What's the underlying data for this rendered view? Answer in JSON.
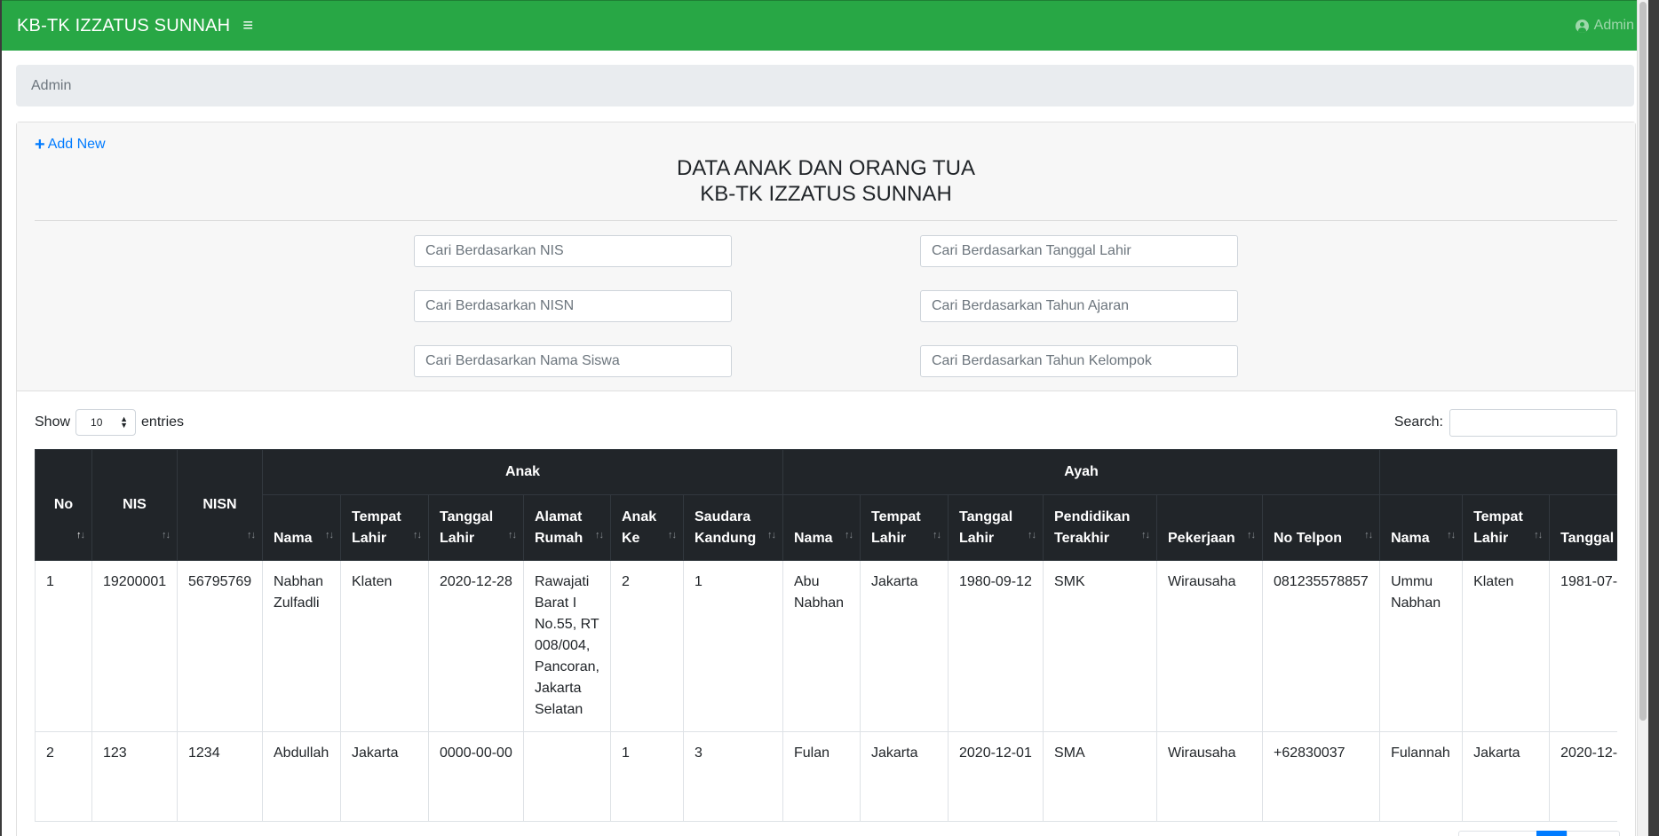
{
  "navbar": {
    "brand": "KB-TK IZZATUS SUNNAH",
    "menu_icon": "hamburger-icon",
    "user_label": "Admin",
    "user_icon": "user-circle-icon",
    "color": "#28a745"
  },
  "breadcrumb": {
    "label": "Admin"
  },
  "header": {
    "add_new_label": "Add New",
    "add_new_icon": "plus-icon",
    "title_line1": "DATA ANAK DAN ORANG TUA",
    "title_line2": "KB-TK IZZATUS SUNNAH"
  },
  "filters": {
    "nis": "Cari Berdasarkan NIS",
    "nisn": "Cari Berdasarkan NISN",
    "nama_siswa": "Cari Berdasarkan Nama Siswa",
    "tanggal_lahir": "Cari Berdasarkan Tanggal Lahir",
    "tahun_ajaran": "Cari Berdasarkan Tahun Ajaran",
    "tahun_kelompok": "Cari Berdasarkan Tahun Kelompok"
  },
  "controls": {
    "show_label": "Show",
    "entries_value": "10",
    "entries_label": "entries",
    "search_label": "Search:"
  },
  "table": {
    "groups": {
      "anak": "Anak",
      "ayah": "Ayah",
      "ibu": ""
    },
    "columns": {
      "no": "No",
      "nis": "NIS",
      "nisn": "NISN",
      "anak_nama": "Nama",
      "anak_tempat": "Tempat Lahir",
      "anak_tanggal": "Tanggal Lahir",
      "anak_alamat": "Alamat Rumah",
      "anak_ke": "Anak Ke",
      "anak_saudara": "Saudara Kandung",
      "ayah_nama": "Nama",
      "ayah_tempat": "Tempat Lahir",
      "ayah_tanggal": "Tanggal Lahir",
      "ayah_pendidikan": "Pendidikan Terakhir",
      "ayah_pekerjaan": "Pekerjaan",
      "ayah_telpon": "No Telpon",
      "ibu_nama": "Nama",
      "ibu_tempat": "Tempat Lahir",
      "ibu_tanggal": "Tanggal Lahir"
    },
    "rows": [
      {
        "no": "1",
        "nis": "19200001",
        "nisn": "56795769",
        "anak_nama": "Nabhan Zulfadli",
        "anak_tempat": "Klaten",
        "anak_tanggal": "2020-12-28",
        "anak_alamat": "Rawajati Barat I No.55, RT 008/004, Pancoran, Jakarta Selatan",
        "anak_ke": "2",
        "anak_saudara": "1",
        "ayah_nama": "Abu Nabhan",
        "ayah_tempat": "Jakarta",
        "ayah_tanggal": "1980-09-12",
        "ayah_pendidikan": "SMK",
        "ayah_pekerjaan": "Wirausaha",
        "ayah_telpon": "081235578857",
        "ibu_nama": "Ummu Nabhan",
        "ibu_tempat": "Klaten",
        "ibu_tanggal": "1981-07-"
      },
      {
        "no": "2",
        "nis": "123",
        "nisn": "1234",
        "anak_nama": "Abdullah",
        "anak_tempat": "Jakarta",
        "anak_tanggal": "0000-00-00",
        "anak_alamat": "",
        "anak_ke": "1",
        "anak_saudara": "3",
        "ayah_nama": "Fulan",
        "ayah_tempat": "Jakarta",
        "ayah_tanggal": "2020-12-01",
        "ayah_pendidikan": "SMA",
        "ayah_pekerjaan": "Wirausaha",
        "ayah_telpon": "+62830037",
        "ibu_nama": "Fulannah",
        "ibu_tempat": "Jakarta",
        "ibu_tanggal": "2020-12-"
      }
    ]
  }
}
